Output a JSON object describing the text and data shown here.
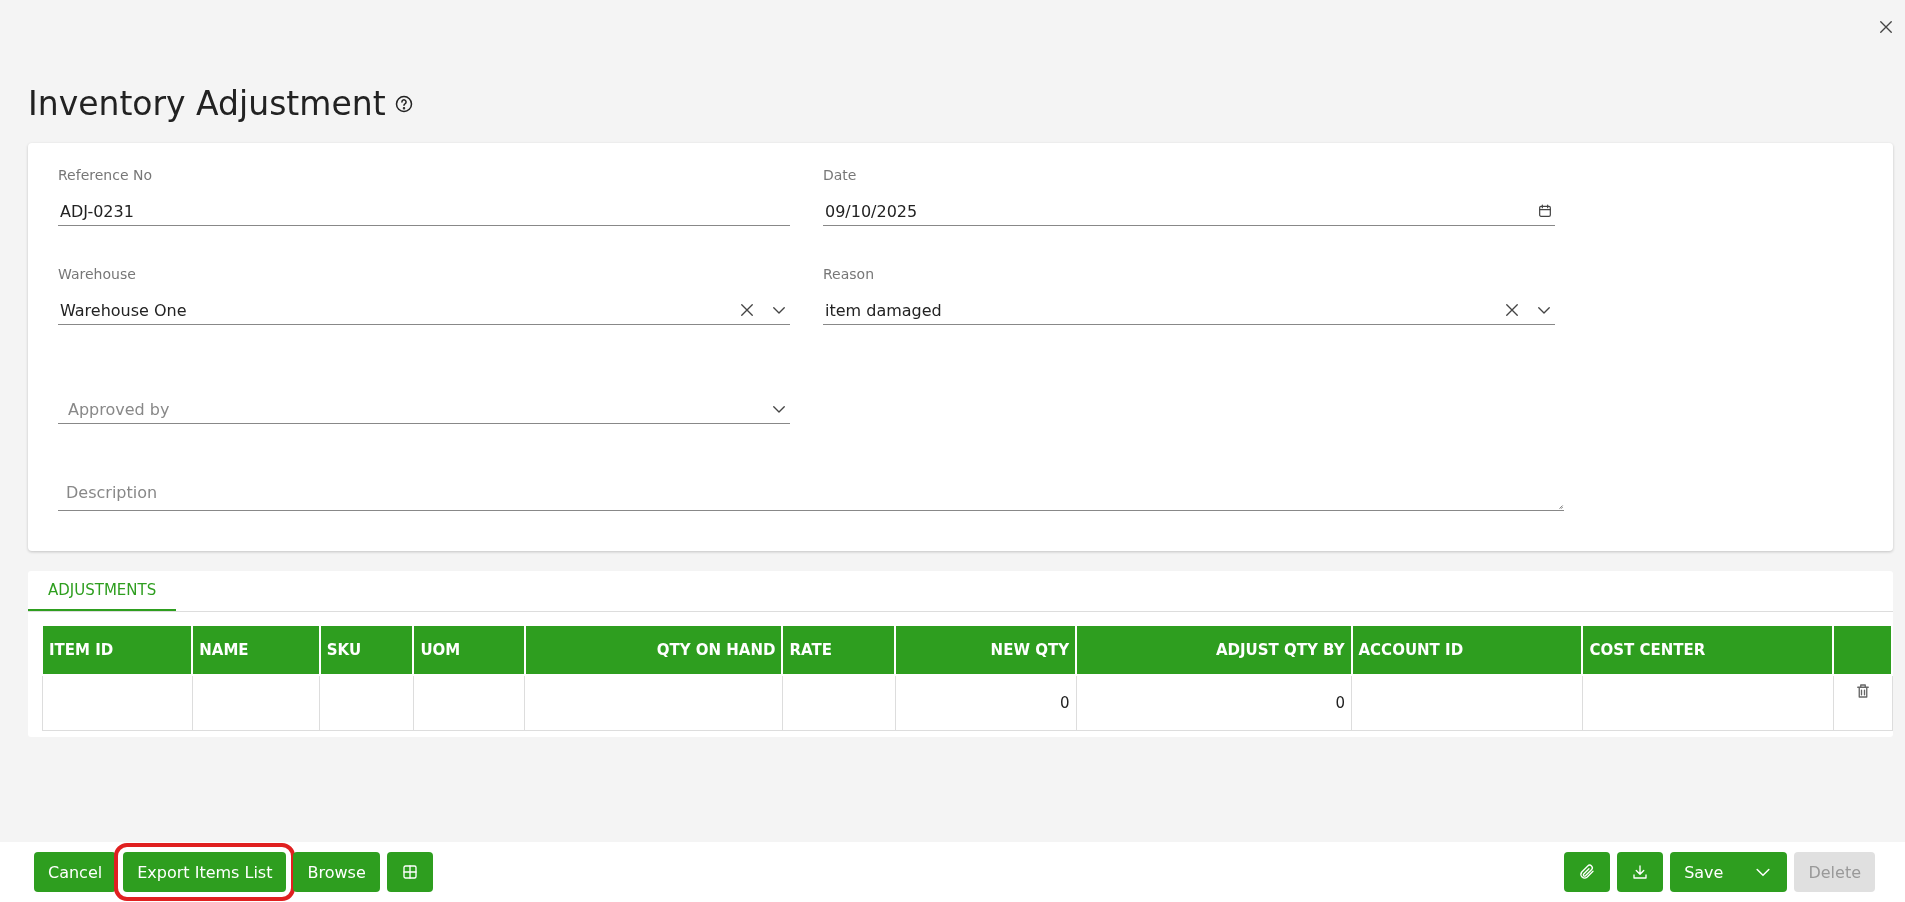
{
  "page": {
    "title": "Inventory Adjustment"
  },
  "form": {
    "fields": [
      {
        "kind": "text",
        "label": "Reference No",
        "value": "ADJ-0231"
      },
      {
        "kind": "date",
        "label": "Date",
        "value": "09/10/2025"
      },
      {
        "kind": "select",
        "label": "Warehouse",
        "value": "Warehouse One",
        "clearable": true
      },
      {
        "kind": "select",
        "label": "Reason",
        "value": "item damaged",
        "clearable": true
      },
      {
        "kind": "select",
        "placeholder": "Approved by",
        "clearable": false
      }
    ],
    "description": {
      "placeholder": "Description"
    }
  },
  "tabs": [
    {
      "label": "ADJUSTMENTS",
      "selected": true
    }
  ],
  "table": {
    "columns": [
      {
        "label": "ITEM ID",
        "kind": "text"
      },
      {
        "label": "NAME",
        "kind": "text"
      },
      {
        "label": "SKU",
        "kind": "text"
      },
      {
        "label": "UOM",
        "kind": "text"
      },
      {
        "label": "QTY ON HAND",
        "kind": "number"
      },
      {
        "label": "RATE",
        "kind": "text"
      },
      {
        "label": "NEW QTY",
        "kind": "number"
      },
      {
        "label": "ADJUST QTY BY",
        "kind": "number"
      },
      {
        "label": "ACCOUNT ID",
        "kind": "text"
      },
      {
        "label": "COST CENTER",
        "kind": "text"
      }
    ],
    "rows": [
      {
        "cells": [
          "",
          "",
          "",
          "",
          "",
          "",
          "0",
          "0",
          "",
          ""
        ]
      }
    ]
  },
  "footer": {
    "left_buttons": [
      {
        "kind": "text",
        "label": "Cancel",
        "highlighted": false
      },
      {
        "kind": "text",
        "label": "Export Items List",
        "highlighted": true
      },
      {
        "kind": "text",
        "label": "Browse",
        "highlighted": false
      },
      {
        "kind": "grid",
        "highlighted": false
      }
    ],
    "right_buttons": [
      {
        "kind": "attach",
        "disabled": false
      },
      {
        "kind": "download",
        "disabled": false
      },
      {
        "kind": "split",
        "label": "Save",
        "disabled": false
      },
      {
        "kind": "text",
        "label": "Delete",
        "disabled": true
      }
    ]
  }
}
